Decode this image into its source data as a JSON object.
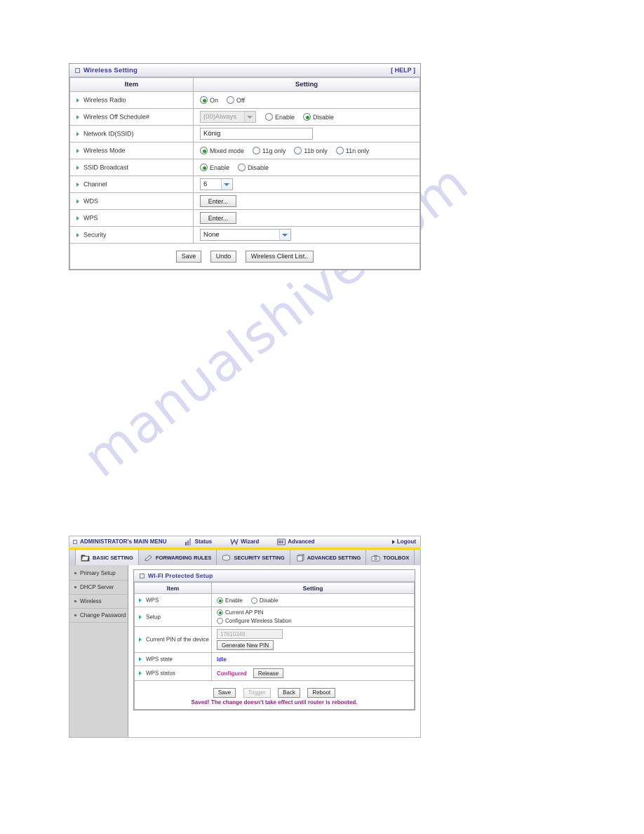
{
  "watermark": {
    "text": "manualshive.com"
  },
  "wireless_panel": {
    "title": "Wireless Setting",
    "help_label": "[ HELP ]",
    "columns": {
      "item": "Item",
      "setting": "Setting"
    },
    "rows": [
      {
        "label": "Wireless Radio",
        "type": "radio",
        "options": [
          {
            "label": "On",
            "selected": true
          },
          {
            "label": "Off",
            "selected": false
          }
        ]
      },
      {
        "label": "Wireless Off Schedule#",
        "type": "schedule",
        "select_value": "(00)Always",
        "options": [
          {
            "label": "Enable",
            "selected": false
          },
          {
            "label": "Disable",
            "selected": true
          }
        ]
      },
      {
        "label": "Network ID(SSID)",
        "type": "text",
        "value": "König"
      },
      {
        "label": "Wireless Mode",
        "type": "radio",
        "options": [
          {
            "label": "Mixed mode",
            "selected": true
          },
          {
            "label": "11g only",
            "selected": false
          },
          {
            "label": "11b only",
            "selected": false
          },
          {
            "label": "11n only",
            "selected": false
          }
        ]
      },
      {
        "label": "SSID Broadcast",
        "type": "radio",
        "options": [
          {
            "label": "Enable",
            "selected": true
          },
          {
            "label": "Disable",
            "selected": false
          }
        ]
      },
      {
        "label": "Channel",
        "type": "select",
        "value": "6"
      },
      {
        "label": "WDS",
        "type": "button",
        "button_label": "Enter..."
      },
      {
        "label": "WPS",
        "type": "button",
        "button_label": "Enter..."
      },
      {
        "label": "Security",
        "type": "select-wide",
        "value": "None"
      }
    ],
    "buttons": [
      {
        "label": "Save"
      },
      {
        "label": "Undo"
      },
      {
        "label": "Wireless Client List.."
      }
    ]
  },
  "router_ui": {
    "main_menu": {
      "title": "ADMINISTRATOR's MAIN MENU",
      "links": [
        {
          "label": "Status",
          "icon": "status-icon"
        },
        {
          "label": "Wizard",
          "icon": "wizard-icon"
        },
        {
          "label": "Advanced",
          "icon": "advanced-icon"
        }
      ],
      "logout_label": "Logout"
    },
    "tabs": [
      {
        "label": "BASIC SETTING",
        "icon": "folder-icon",
        "active": true
      },
      {
        "label": "FORWARDING RULES",
        "icon": "forward-icon",
        "active": false
      },
      {
        "label": "SECURITY SETTING",
        "icon": "shield-icon",
        "active": false
      },
      {
        "label": "ADVANCED SETTING",
        "icon": "tools-icon",
        "active": false
      },
      {
        "label": "TOOLBOX",
        "icon": "toolbox-icon",
        "active": false
      }
    ],
    "sidebar": {
      "items": [
        {
          "label": "Primary Setup"
        },
        {
          "label": "DHCP Server"
        },
        {
          "label": "Wireless"
        },
        {
          "label": "Change Password"
        }
      ]
    },
    "wps_panel": {
      "title": "WI-FI Protected Setup",
      "columns": {
        "item": "Item",
        "setting": "Setting"
      },
      "rows": [
        {
          "label": "WPS",
          "type": "radio",
          "options": [
            {
              "label": "Enable",
              "selected": true
            },
            {
              "label": "Disable",
              "selected": false
            }
          ]
        },
        {
          "label": "Setup",
          "type": "radio-col",
          "options": [
            {
              "label": "Current AP PIN",
              "selected": true
            },
            {
              "label": "Configure Wireless Station",
              "selected": false
            }
          ]
        },
        {
          "label": "Current PIN of the device",
          "type": "pin",
          "value": "17610348",
          "button_label": "Generate New PIN"
        },
        {
          "label": "WPS state",
          "type": "state",
          "value": "Idle"
        },
        {
          "label": "WPS status",
          "type": "status",
          "value": "Configured",
          "button_label": "Release"
        }
      ],
      "buttons": [
        {
          "label": "Save",
          "disabled": false
        },
        {
          "label": "Trigger",
          "disabled": true
        },
        {
          "label": "Back",
          "disabled": false
        },
        {
          "label": "Reboot",
          "disabled": false
        }
      ],
      "saved_message": "Saved! The change doesn't take effect until router is rebooted."
    }
  },
  "colors": {
    "title_text": "#3b3b8f",
    "accent_yellow": "#f2c900",
    "radio_green": "#1fa01f",
    "state_blue": "#3333cc",
    "status_magenta": "#b0309a",
    "saved_purple": "#8c1f7a",
    "watermark": "#d9d9f2"
  }
}
